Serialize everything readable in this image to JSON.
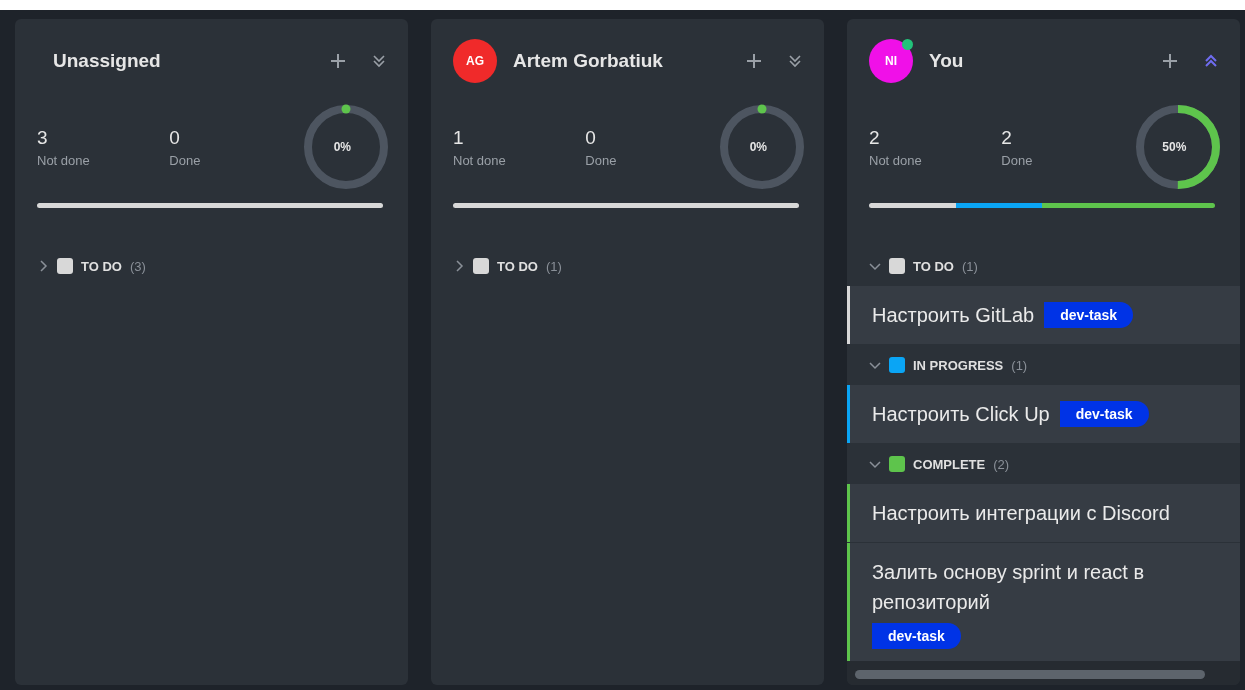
{
  "columns": [
    {
      "name": "Unassigned",
      "expanded": false,
      "not_done": "3",
      "not_done_label": "Not done",
      "done": "0",
      "done_label": "Done",
      "percent": "0%",
      "groups": [
        {
          "name": "TO DO",
          "count": "(3)",
          "color": "#d8d8d8",
          "expanded": false
        }
      ]
    },
    {
      "name": "Artem Gorbatiuk",
      "avatar": {
        "initials": "AG",
        "color": "#f02a2a",
        "online": false
      },
      "expanded": false,
      "not_done": "1",
      "not_done_label": "Not done",
      "done": "0",
      "done_label": "Done",
      "percent": "0%",
      "groups": [
        {
          "name": "TO DO",
          "count": "(1)",
          "color": "#d8d8d8",
          "expanded": false
        }
      ]
    },
    {
      "name": "You",
      "avatar": {
        "initials": "NI",
        "color": "#f010e8",
        "online": true
      },
      "expanded": true,
      "not_done": "2",
      "not_done_label": "Not done",
      "done": "2",
      "done_label": "Done",
      "percent": "50%",
      "groups": [
        {
          "name": "TO DO",
          "count": "(1)",
          "color": "#d8d8d8",
          "expanded": true,
          "tasks": [
            {
              "title": "Настроить GitLab",
              "tag": "dev-task"
            }
          ]
        },
        {
          "name": "IN PROGRESS",
          "count": "(1)",
          "color": "#0aa5f5",
          "expanded": true,
          "tasks": [
            {
              "title": "Настроить Click Up",
              "tag": "dev-task"
            }
          ]
        },
        {
          "name": "COMPLETE",
          "count": "(2)",
          "color": "#5ec44c",
          "expanded": true,
          "tasks": [
            {
              "title": "Настроить интеграции с Discord"
            },
            {
              "title": "Залить основу sprint и react в репозиторий",
              "tag": "dev-task"
            }
          ]
        }
      ]
    }
  ]
}
